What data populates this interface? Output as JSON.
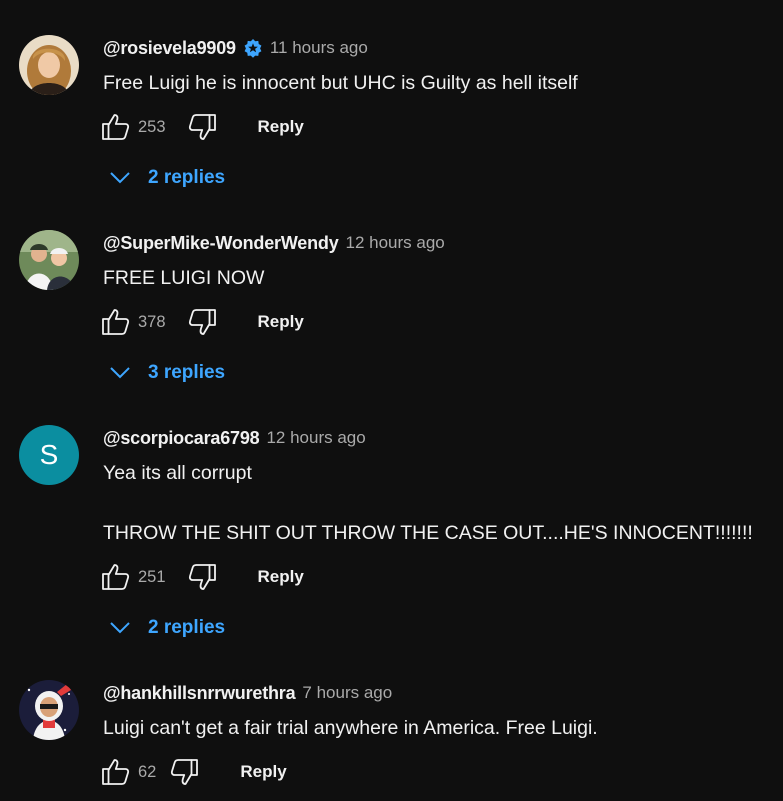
{
  "accent_color": "#3ea6ff",
  "background_color": "#0f0f0f",
  "comments": [
    {
      "handle": "@rosievela9909",
      "verified_icon": "verified-check-icon",
      "time": "11 hours ago",
      "text": "Free Luigi he is innocent but UHC is Guilty as hell itself",
      "likes": "253",
      "reply_label": "Reply",
      "replies_label": "2 replies"
    },
    {
      "handle": "@SuperMike-WonderWendy",
      "time": "12 hours ago",
      "text": "FREE LUIGI NOW",
      "likes": "378",
      "reply_label": "Reply",
      "replies_label": "3 replies"
    },
    {
      "handle": "@scorpiocara6798",
      "avatar_letter": "S",
      "time": "12 hours ago",
      "text_line1": "Yea its all corrupt",
      "text_line2": "THROW THE SHIT OUT THROW THE CASE OUT....HE'S INNOCENT!!!!!!!",
      "likes": "251",
      "reply_label": "Reply",
      "replies_label": "2 replies"
    },
    {
      "handle": "@hankhillsnrrwurethra",
      "time": "7 hours ago",
      "text": "Luigi can't get a fair trial anywhere in America. Free Luigi.",
      "likes": "62",
      "reply_label": "Reply"
    }
  ]
}
